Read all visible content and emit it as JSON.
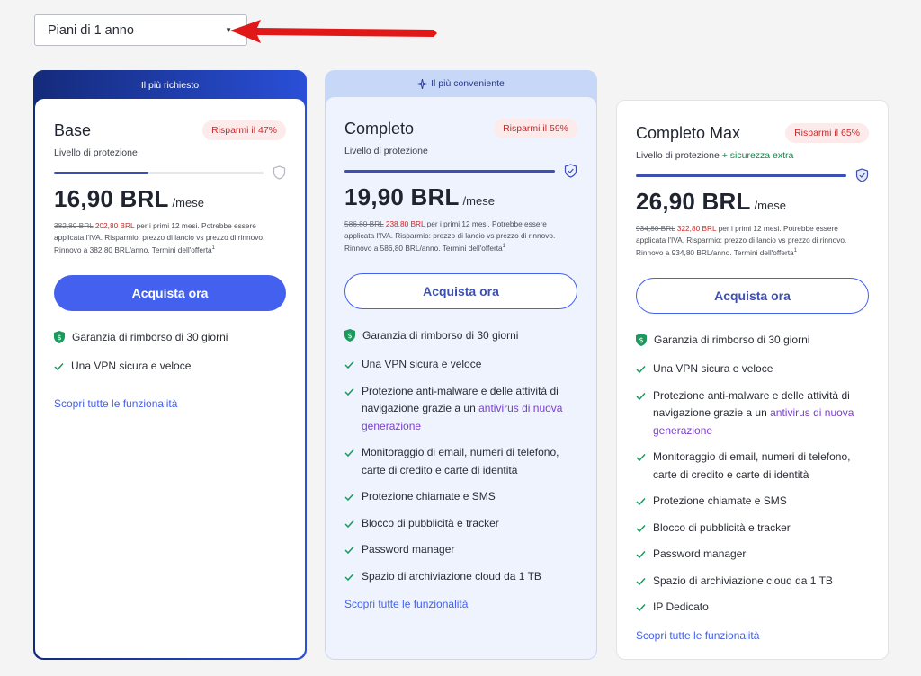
{
  "dropdown": {
    "selected": "Piani di 1 anno"
  },
  "plans": [
    {
      "banner": "Il più richiesto",
      "name": "Base",
      "badge": "Risparmi il 47%",
      "protection_label": "Livello di protezione",
      "protection_level": 0.45,
      "price": "16,90 BRL",
      "per": "/mese",
      "old_price": "382,80 BRL",
      "new_price": "202,80 BRL",
      "fine_print": " per i primi 12 mesi. Potrebbe essere applicata l'IVA. Risparmio: prezzo di lancio vs prezzo di rinnovo. Rinnovo a 382,80 BRL/anno. Termini dell'offerta",
      "cta": "Acquista ora",
      "guarantee": "Garanzia di rimborso di 30 giorni",
      "features": [
        "Una VPN sicura e veloce"
      ],
      "discover": "Scopri tutte le funzionalità"
    },
    {
      "banner": "Il più conveniente",
      "name": "Completo",
      "badge": "Risparmi il 59%",
      "protection_label": "Livello di protezione",
      "protection_level": 1.0,
      "price": "19,90 BRL",
      "per": "/mese",
      "old_price": "586,80 BRL",
      "new_price": "238,80 BRL",
      "fine_print": " per i primi 12 mesi. Potrebbe essere applicata l'IVA. Risparmio: prezzo di lancio vs prezzo di rinnovo. Rinnovo a 586,80 BRL/anno. Termini dell'offerta",
      "cta": "Acquista ora",
      "guarantee": "Garanzia di rimborso di 30 giorni",
      "features": [
        "Una VPN sicura e veloce",
        "Protezione anti-malware e delle attività di navigazione grazie a un ",
        "Monitoraggio di email, numeri di telefono, carte di credito e carte di identità",
        "Protezione chiamate e SMS",
        "Blocco di pubblicità e tracker",
        "Password manager",
        "Spazio di archiviazione cloud da 1 TB"
      ],
      "antivirus_link": "antivirus di nuova generazione",
      "discover": "Scopri tutte le funzionalità"
    },
    {
      "name": "Completo Max",
      "badge": "Risparmi il 65%",
      "protection_label": "Livello di protezione",
      "protection_extra": " + sicurezza extra",
      "protection_level": 1.0,
      "price": "26,90 BRL",
      "per": "/mese",
      "old_price": "934,80 BRL",
      "new_price": "322,80 BRL",
      "fine_print": " per i primi 12 mesi. Potrebbe essere applicata l'IVA. Risparmio: prezzo di lancio vs prezzo di rinnovo. Rinnovo a 934,80 BRL/anno. Termini dell'offerta",
      "cta": "Acquista ora",
      "guarantee": "Garanzia di rimborso di 30 giorni",
      "features": [
        "Una VPN sicura e veloce",
        "Protezione anti-malware e delle attività di navigazione grazie a un ",
        "Monitoraggio di email, numeri di telefono, carte di credito e carte di identità",
        "Protezione chiamate e SMS",
        "Blocco di pubblicità e tracker",
        "Password manager",
        "Spazio di archiviazione cloud da 1 TB",
        "IP Dedicato"
      ],
      "antivirus_link": "antivirus di nuova generazione",
      "discover": "Scopri tutte le funzionalità"
    }
  ],
  "colors": {
    "accent": "#4361ee",
    "save_red": "#c92a2a",
    "check_green": "#1a9a5c",
    "banner_dark": "#1e2b8f"
  }
}
